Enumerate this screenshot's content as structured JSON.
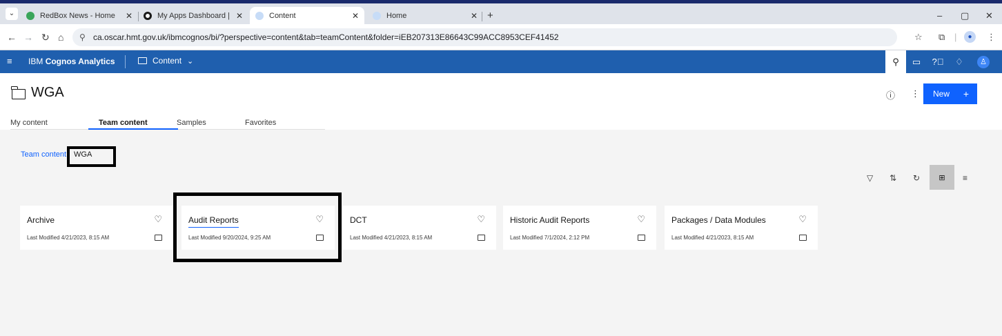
{
  "browser": {
    "tabs": [
      {
        "title": "RedBox News - Home",
        "active": false,
        "favicon_color": "#3aa55a"
      },
      {
        "title": "My Apps Dashboard | oscar",
        "active": false,
        "favicon_color": "#1a1a1a"
      },
      {
        "title": "Content",
        "active": true,
        "favicon_color": "#7aa7e8"
      },
      {
        "title": "Home",
        "active": false,
        "favicon_color": "#7aa7e8"
      }
    ],
    "url": "ca.oscar.hmt.gov.uk/ibmcognos/bi/?perspective=content&tab=teamContent&folder=iEB207313E86643C99ACC8953CEF41452",
    "window_controls": [
      "–",
      "▢",
      "✕"
    ]
  },
  "app": {
    "brand_prefix": "IBM",
    "brand_name": "Cognos Analytics",
    "content_menu_label": "Content",
    "header_icons": [
      "search-icon",
      "chat-icon",
      "help-icon",
      "notification-icon",
      "user-icon"
    ],
    "header_color": "#1f5fae"
  },
  "page": {
    "title": "WGA",
    "new_button_label": "New",
    "new_button_plus": "+",
    "tabs": [
      {
        "label": "My content",
        "active": false
      },
      {
        "label": "Team content",
        "active": true
      },
      {
        "label": "Samples",
        "active": false
      },
      {
        "label": "Favorites",
        "active": false
      }
    ],
    "breadcrumb": {
      "root": "Team content",
      "current": "WGA"
    }
  },
  "toolbar": {
    "icons": [
      "filter-icon",
      "sort-icon",
      "refresh-icon",
      "grid-view-icon",
      "list-view-icon"
    ]
  },
  "cards": [
    {
      "name": "Archive",
      "modified": "Last Modified 4/21/2023, 8:15 AM"
    },
    {
      "name": "Audit Reports",
      "modified": "Last Modified 9/20/2024, 9:25 AM"
    },
    {
      "name": "DCT",
      "modified": "Last Modified 4/21/2023, 8:15 AM"
    },
    {
      "name": "Historic Audit Reports",
      "modified": "Last Modified 7/1/2024, 2:12 PM"
    },
    {
      "name": "Packages / Data Modules",
      "modified": "Last Modified 4/21/2023, 8:15 AM"
    }
  ]
}
